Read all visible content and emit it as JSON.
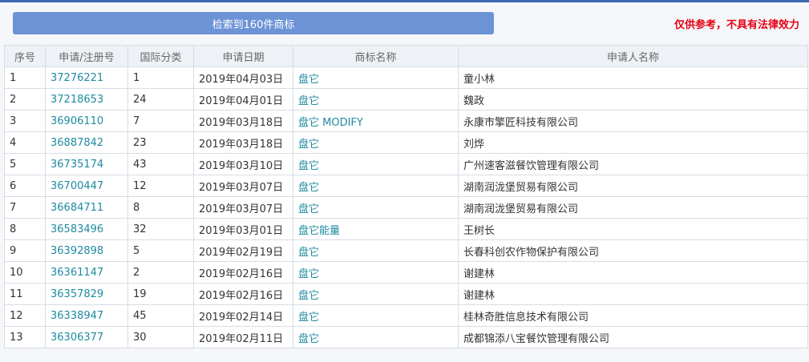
{
  "search": {
    "banner": "检索到160件商标"
  },
  "disclaimer": "仅供参考，不具有法律效力",
  "table": {
    "headers": [
      "序号",
      "申请/注册号",
      "国际分类",
      "申请日期",
      "商标名称",
      "申请人名称"
    ],
    "rows": [
      [
        "1",
        "37276221",
        "1",
        "2019年04月03日",
        "盘它",
        "童小林"
      ],
      [
        "2",
        "37218653",
        "24",
        "2019年04月01日",
        "盘它",
        "魏政"
      ],
      [
        "3",
        "36906110",
        "7",
        "2019年03月18日",
        "盘它 MODIFY",
        "永康市擎匠科技有限公司"
      ],
      [
        "4",
        "36887842",
        "23",
        "2019年03月18日",
        "盘它",
        "刘烨"
      ],
      [
        "5",
        "36735174",
        "43",
        "2019年03月10日",
        "盘它",
        "广州速客滋餐饮管理有限公司"
      ],
      [
        "6",
        "36700447",
        "12",
        "2019年03月07日",
        "盘它",
        "湖南润泷堡贸易有限公司"
      ],
      [
        "7",
        "36684711",
        "8",
        "2019年03月07日",
        "盘它",
        "湖南润泷堡贸易有限公司"
      ],
      [
        "8",
        "36583496",
        "32",
        "2019年03月01日",
        "盘它能量",
        "王树长"
      ],
      [
        "9",
        "36392898",
        "5",
        "2019年02月19日",
        "盘它",
        "长春科创农作物保护有限公司"
      ],
      [
        "10",
        "36361147",
        "2",
        "2019年02月16日",
        "盘它",
        "谢建林"
      ],
      [
        "11",
        "36357829",
        "19",
        "2019年02月16日",
        "盘它",
        "谢建林"
      ],
      [
        "12",
        "36338947",
        "45",
        "2019年02月14日",
        "盘它",
        "桂林奇胜信息技术有限公司"
      ],
      [
        "13",
        "36306377",
        "30",
        "2019年02月11日",
        "盘它",
        "成都锦添八宝餐饮管理有限公司"
      ]
    ]
  }
}
